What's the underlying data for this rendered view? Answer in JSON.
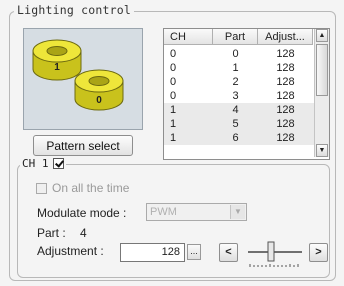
{
  "panel": {
    "title": "Lighting control"
  },
  "preview": {
    "ring_labels": [
      "1",
      "0"
    ],
    "ring_color": "#e8e22a"
  },
  "pattern_select_label": "Pattern select",
  "table": {
    "headers": [
      "CH",
      "Part",
      "Adjust..."
    ],
    "rows": [
      [
        "0",
        "0",
        "128"
      ],
      [
        "0",
        "1",
        "128"
      ],
      [
        "0",
        "2",
        "128"
      ],
      [
        "0",
        "3",
        "128"
      ],
      [
        "1",
        "4",
        "128"
      ],
      [
        "1",
        "5",
        "128"
      ],
      [
        "1",
        "6",
        "128"
      ]
    ],
    "selected_row_index": 4
  },
  "ch_group": {
    "title": "CH 1",
    "enabled": true,
    "on_all_the_time_label": "On all the time",
    "on_all_the_time_checked": false,
    "modulate_mode_label": "Modulate mode :",
    "modulate_mode_value": "PWM",
    "part_label": "Part :",
    "part_value": "4",
    "adjustment_label": "Adjustment :",
    "adjustment_value": "128",
    "dots_label": "...",
    "decrement_label": "<",
    "increment_label": ">"
  }
}
